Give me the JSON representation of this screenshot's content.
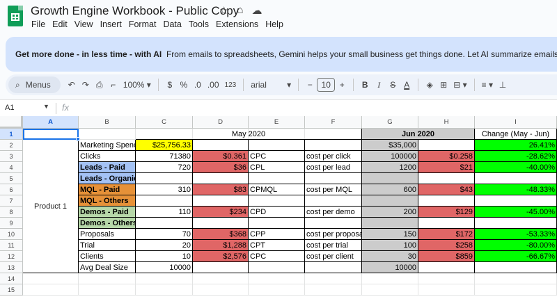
{
  "app": {
    "doc_title": "Growth Engine Workbook - Public Copy",
    "menus": [
      "File",
      "Edit",
      "View",
      "Insert",
      "Format",
      "Data",
      "Tools",
      "Extensions",
      "Help"
    ]
  },
  "banner": {
    "bold_text": "Get more done - in less time - with AI",
    "text": "From emails to spreadsheets, Gemini helps your small business get things done. Let AI summarize emails, draft"
  },
  "toolbar": {
    "menus_label": "Menus",
    "zoom": "100%",
    "currency": "$",
    "percent": "%",
    "dec_decrease": ".0",
    "dec_increase": ".00",
    "number_format": "123",
    "font": "arial",
    "font_size": "10"
  },
  "formula_bar": {
    "name_box": "A1",
    "fx": "fx"
  },
  "columns": [
    "A",
    "B",
    "C",
    "D",
    "E",
    "F",
    "G",
    "H",
    "I"
  ],
  "rows": [
    "1",
    "2",
    "3",
    "4",
    "5",
    "6",
    "7",
    "8",
    "9",
    "10",
    "11",
    "12",
    "13",
    "14",
    "15"
  ],
  "sheet": {
    "header_may": "May 2020",
    "header_jun": "Jun 2020",
    "header_change": "Change  (May - Jun)",
    "product": "Product 1",
    "r2": {
      "b": "Marketing Spend",
      "c": "$25,756.33",
      "g": "$35,000",
      "i": "26.41%"
    },
    "r3": {
      "b": "Clicks",
      "c": "71380",
      "d": "$0.361",
      "e": "CPC",
      "f": "cost per click",
      "g": "100000",
      "h": "$0.258",
      "i": "-28.62%"
    },
    "r4": {
      "b": "Leads - Paid",
      "c": "720",
      "d": "$36",
      "e": "CPL",
      "f": "cost per lead",
      "g": "1200",
      "h": "$21",
      "i": "-40.00%"
    },
    "r5": {
      "b": "Leads - Organic"
    },
    "r6": {
      "b": "MQL - Paid",
      "c": "310",
      "d": "$83",
      "e": "CPMQL",
      "f": "cost per MQL",
      "g": "600",
      "h": "$43",
      "i": "-48.33%"
    },
    "r7": {
      "b": "MQL - Others"
    },
    "r8": {
      "b": "Demos - Paid",
      "c": "110",
      "d": "$234",
      "e": "CPD",
      "f": "cost per demo",
      "g": "200",
      "h": "$129",
      "i": "-45.00%"
    },
    "r9": {
      "b": "Demos - Others"
    },
    "r10": {
      "b": "Proposals",
      "c": "70",
      "d": "$368",
      "e": "CPP",
      "f": "cost per proposal",
      "g": "150",
      "h": "$172",
      "i": "-53.33%"
    },
    "r11": {
      "b": "Trial",
      "c": "20",
      "d": "$1,288",
      "e": "CPT",
      "f": "cost per trial",
      "g": "100",
      "h": "$258",
      "i": "-80.00%"
    },
    "r12": {
      "b": "Clients",
      "c": "10",
      "d": "$2,576",
      "e": "CPC",
      "f": "cost per client",
      "g": "30",
      "h": "$859",
      "i": "-66.67%"
    },
    "r13": {
      "b": "Avg Deal Size",
      "c": "10000",
      "g": "10000"
    }
  },
  "colors": {
    "gray": "#cccccc",
    "red": "#e06666",
    "green": "#00ff00",
    "yellow": "#ffff00",
    "blue": "#a4c2f4",
    "orange": "#e69138",
    "light_green": "#b6d7a8",
    "accent": "#1a73e8"
  }
}
